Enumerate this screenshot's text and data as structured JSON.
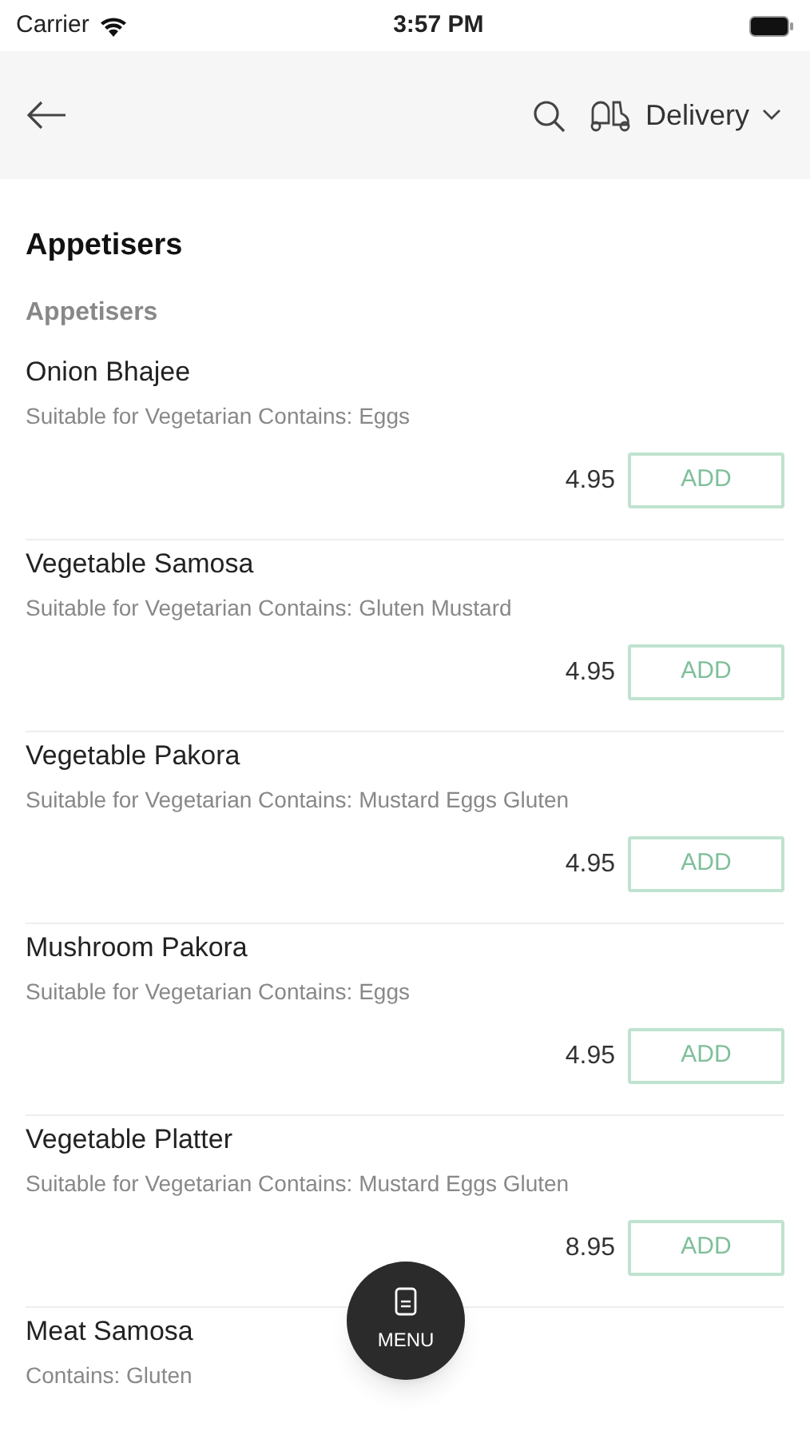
{
  "status_bar": {
    "carrier": "Carrier",
    "time": "3:57 PM"
  },
  "header": {
    "mode": "Delivery"
  },
  "section": {
    "title": "Appetisers",
    "subtitle": "Appetisers"
  },
  "items": [
    {
      "name": "Onion Bhajee",
      "description": "Suitable for Vegetarian Contains: Eggs",
      "price": "4.95",
      "button": "ADD"
    },
    {
      "name": "Vegetable Samosa",
      "description": "Suitable for Vegetarian Contains: Gluten Mustard",
      "price": "4.95",
      "button": "ADD"
    },
    {
      "name": "Vegetable Pakora",
      "description": "Suitable for Vegetarian Contains: Mustard Eggs Gluten",
      "price": "4.95",
      "button": "ADD"
    },
    {
      "name": "Mushroom Pakora",
      "description": "Suitable for Vegetarian Contains: Eggs",
      "price": "4.95",
      "button": "ADD"
    },
    {
      "name": "Vegetable Platter",
      "description": "Suitable for Vegetarian Contains: Mustard Eggs Gluten",
      "price": "8.95",
      "button": "ADD"
    },
    {
      "name": "Meat Samosa",
      "description": "Contains: Gluten"
    }
  ],
  "fab": {
    "label": "MENU"
  }
}
